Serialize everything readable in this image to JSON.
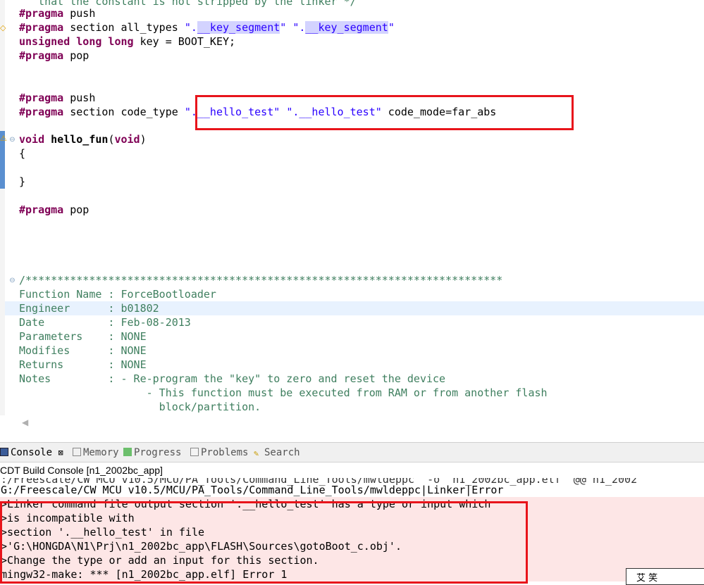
{
  "editor": {
    "lines": {
      "l0": "   that the constant is not stripped by the linker */",
      "l1_kw": "#pragma",
      "l1_rest": " push",
      "l2_kw": "#pragma",
      "l2_a": " section all_types ",
      "l2_s1a": "\".",
      "l2_s1b": "__key_segment",
      "l2_s1c": "\"",
      "l2_sp": " ",
      "l2_s2a": "\".",
      "l2_s2b": "__key_segment",
      "l2_s2c": "\"",
      "l3_kw": "unsigned long long",
      "l3_rest": " key = BOOT_KEY;",
      "l4_kw": "#pragma",
      "l4_rest": " pop",
      "l5_kw": "#pragma",
      "l5_rest": " push",
      "l6_kw": "#pragma",
      "l6_a": " section code_type ",
      "l6_s1": "\".__hello_test\"",
      "l6_sp": " ",
      "l6_s2": "\".__hello_test\"",
      "l6_b": " code_mode=far_abs",
      "l7_kw": "void",
      "l7_name": " hello_fun",
      "l7_p1": "(",
      "l7_kw2": "void",
      "l7_p2": ")",
      "l8": "{",
      "l9": "}",
      "l10_kw": "#pragma",
      "l10_rest": " pop",
      "c0": "/***************************************************************************",
      "c1": "Function Name : ForceBootloader",
      "c2": "Engineer      : b01802",
      "c3": "Date          : Feb-08-2013",
      "c4": "Parameters    : NONE",
      "c5": "Modifies      : NONE",
      "c6": "Returns       : NONE",
      "c7": "Notes         : - Re-program the \"key\" to zero and reset the device",
      "c8": "                    - This function must be executed from RAM or from another flash",
      "c9": "                      block/partition."
    }
  },
  "console": {
    "tabs": {
      "console": "Console",
      "console_close": "⊠",
      "memory": "Memory",
      "progress": "Progress",
      "problems": "Problems",
      "search": "Search"
    },
    "title": "CDT Build Console [n1_2002bc_app]",
    "lines": {
      "t0": " :/Freescale/CW MCU v10.5/MCU/PA_Tools/Command_Line_Tools/mwldeppc  -o  n1_2002bc_app.elf  @@ n1_2002",
      "t1": " G:/Freescale/CW MCU v10.5/MCU/PA_Tools/Command_Line_Tools/mwldeppc|Linker|Error",
      "t2": " >Linker command file output section '.__hello_test' has a type or input which",
      "t3": " >is incompatible with",
      "t4": " >section '.__hello_test' in file",
      "t5": " >'G:\\HONGDA\\N1\\Prj\\n1_2002bc_app\\FLASH\\Sources\\gotoBoot_c.obj'.",
      "t6": " >Change the type or add an input for this section.",
      "t7": " mingw32-make: *** [n1_2002bc_app.elf] Error 1"
    },
    "overlay": "艾  笑"
  }
}
